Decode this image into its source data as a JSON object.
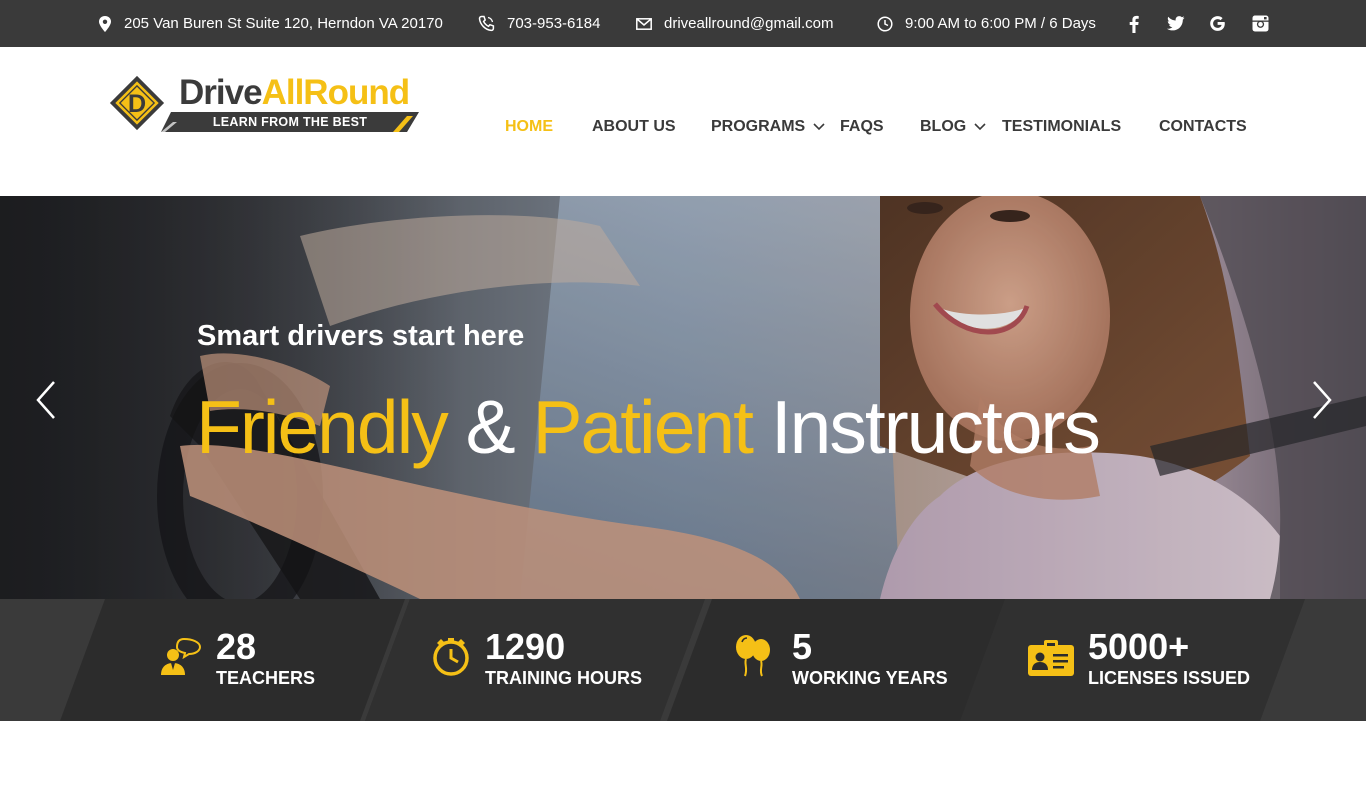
{
  "topbar": {
    "address": "205 Van Buren St Suite 120, Herndon VA 20170",
    "phone": "703-953-6184",
    "email": "driveallround@gmail.com",
    "hours": "9:00 AM to 6:00 PM / 6 Days",
    "social": [
      {
        "name": "facebook-icon",
        "glyph": "f"
      },
      {
        "name": "twitter-icon",
        "glyph": "t"
      },
      {
        "name": "google-icon",
        "glyph": "G"
      },
      {
        "name": "instagram-icon",
        "glyph": "ig"
      }
    ]
  },
  "logo": {
    "name_part1": "Drive",
    "name_part2": "AllRound",
    "letter": "D",
    "tagline": "LEARN FROM THE BEST"
  },
  "nav": {
    "home": "HOME",
    "about": "ABOUT US",
    "programs": "PROGRAMS",
    "faqs": "FAQS",
    "blog": "BLOG",
    "testimonials": "TESTIMONIALS",
    "contacts": "CONTACTS",
    "active": "HOME"
  },
  "hero": {
    "subtitle": "Smart drivers start here",
    "title_part1": "Friendly",
    "title_part2": "&",
    "title_part3": "Patient",
    "title_part4": "Instructors"
  },
  "stats": [
    {
      "value": "28",
      "label": "TEACHERS",
      "icon": "teacher-icon"
    },
    {
      "value": "1290",
      "label": "TRAINING HOURS",
      "icon": "clock-icon"
    },
    {
      "value": "5",
      "label": "WORKING YEARS",
      "icon": "balloons-icon"
    },
    {
      "value": "5000+",
      "label": "LICENSES ISSUED",
      "icon": "license-card-icon"
    }
  ],
  "colors": {
    "accent": "#f5c016",
    "topbar_bg": "#3a3a3a",
    "nav_text": "#3a3a3a",
    "stats_bg": "#2f2f2f"
  }
}
